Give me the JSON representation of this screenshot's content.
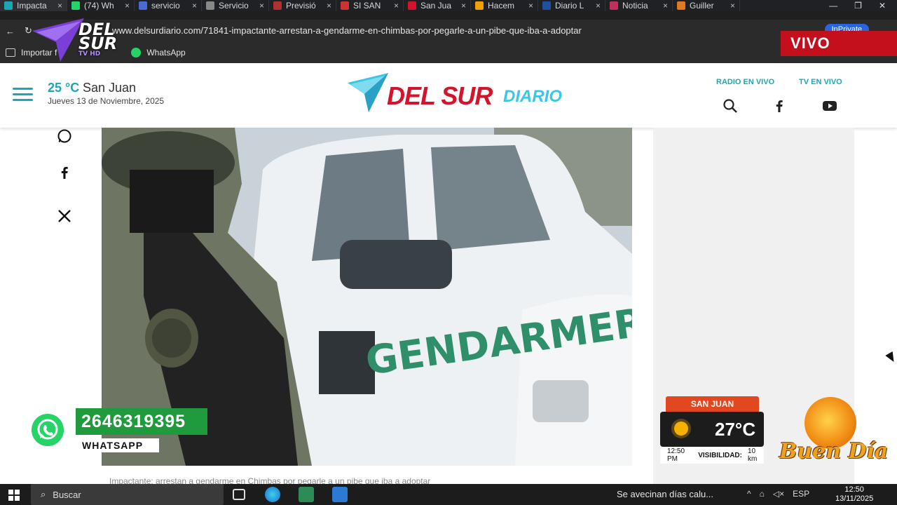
{
  "browser": {
    "tabs": [
      {
        "label": "Impacta",
        "color": "#1aa6b7",
        "active": true
      },
      {
        "label": "(74) Wh",
        "color": "#25d366"
      },
      {
        "label": "servicio",
        "color": "#4a6ad6"
      },
      {
        "label": "Servicio",
        "color": "#888888"
      },
      {
        "label": "Previsió",
        "color": "#b03030"
      },
      {
        "label": "SI SAN",
        "color": "#cc3333"
      },
      {
        "label": "San Jua",
        "color": "#d3142a"
      },
      {
        "label": "Hacem",
        "color": "#f0a000"
      },
      {
        "label": "Diario L",
        "color": "#2250a0"
      },
      {
        "label": "Noticia",
        "color": "#c0305a"
      },
      {
        "label": "Guiller",
        "color": "#e07a20"
      }
    ],
    "url": "www.delsurdiario.com/71841-impactante-arrestan-a-gendarme-en-chimbas-por-pegarle-a-un-pibe-que-iba-a-adoptar",
    "inprivate": "InPrivate",
    "bookmarks": [
      {
        "label": "Importar f",
        "icon": "import-icon"
      },
      {
        "label": "WhatsApp",
        "icon": "whatsapp-icon"
      }
    ]
  },
  "overlay": {
    "vivo": "VIVO",
    "tv_logo_line1": "DEL",
    "tv_logo_line2": "SUR",
    "tv_logo_sub": "TV HD"
  },
  "site": {
    "temp": "25 °C",
    "city": "San Juan",
    "date": "Jueves 13 de Noviembre, 2025",
    "logo_main": "DEL SUR",
    "logo_sub": "DIARIO",
    "nav_radio": "RADIO EN VIVO",
    "nav_tv": "TV EN VIVO",
    "caption": "Impactante: arrestan a gendarme en Chimbas por pegarle a un pibe que iba a adoptar",
    "photo_text": "GENDARMERIA"
  },
  "whatsapp_overlay": {
    "number": "2646319395",
    "label": "WHATSAPP"
  },
  "weather_widget": {
    "city": "SAN JUAN",
    "temp": "27°C",
    "time": "12:50 PM",
    "visibility_label": "VISIBILIDAD:",
    "visibility_value": "10 km"
  },
  "buen_dia": "Buen Día",
  "taskbar": {
    "search": "Buscar",
    "news": "Se avecinan días calu...",
    "lang": "ESP",
    "time": "12:50",
    "date": "13/11/2025"
  }
}
